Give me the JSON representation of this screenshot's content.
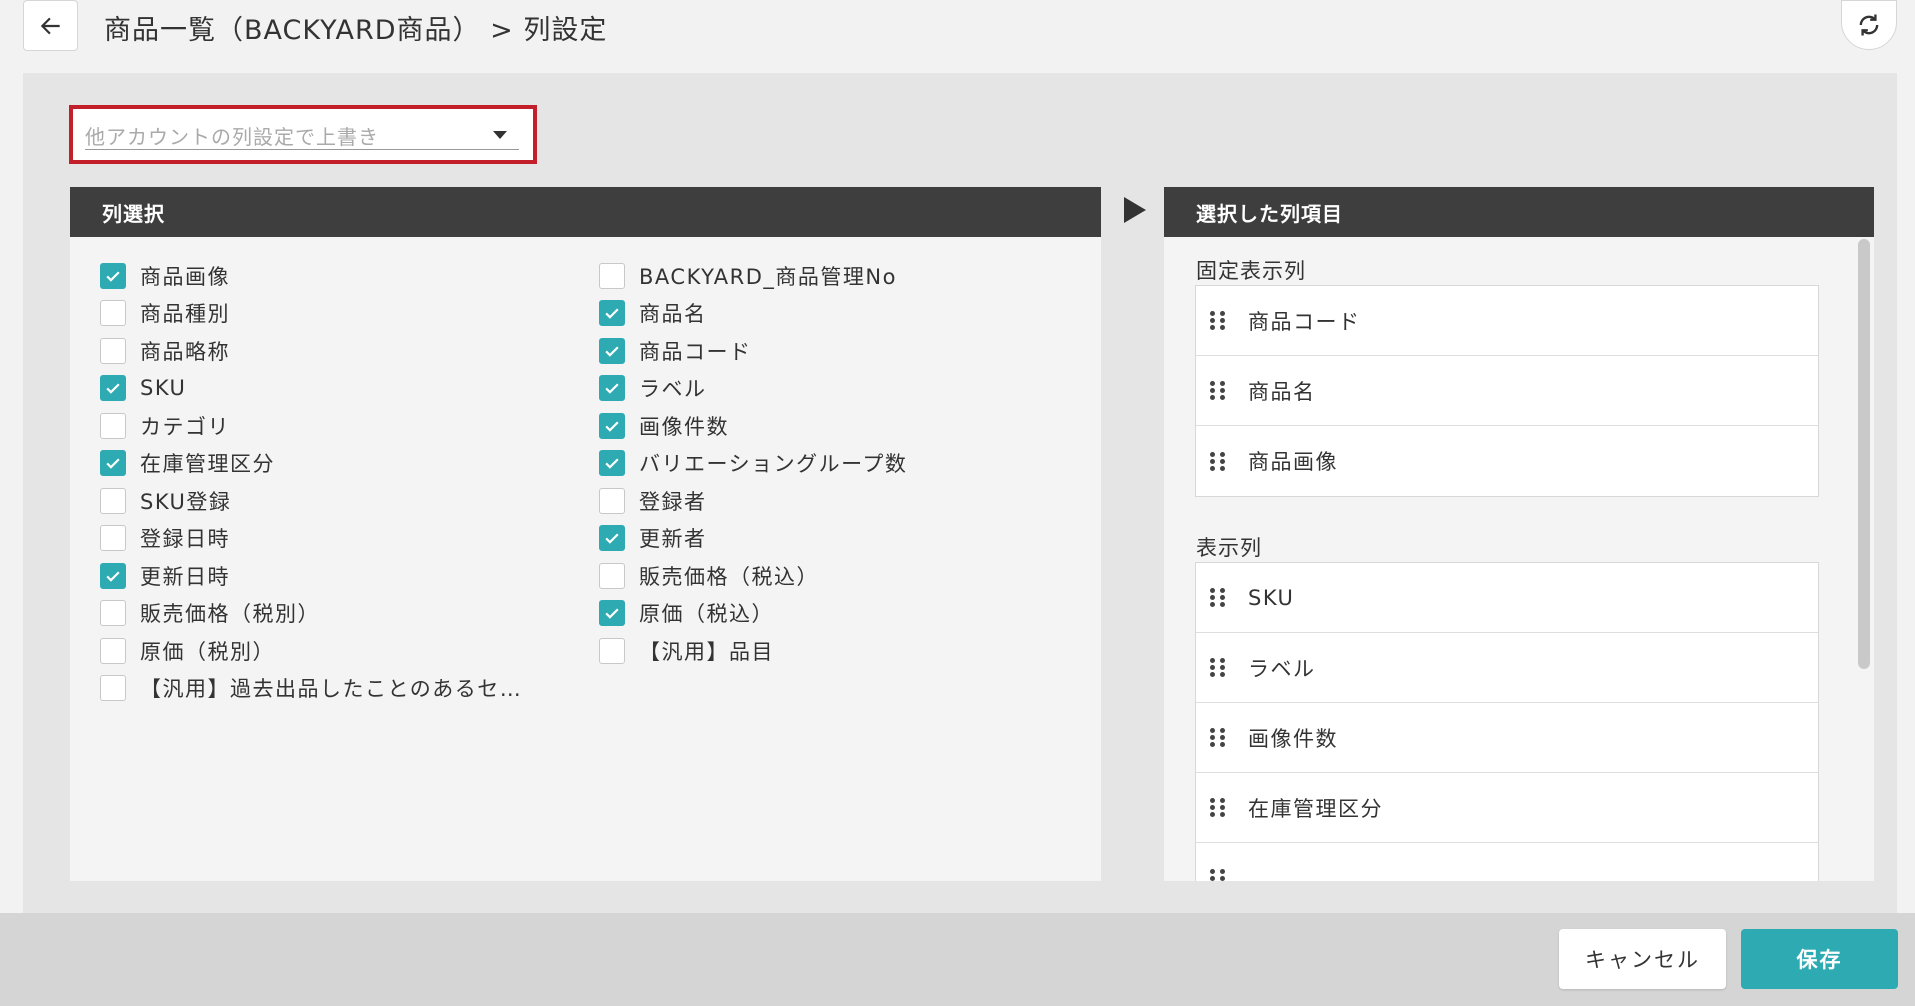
{
  "header": {
    "title": "商品一覧（BACKYARD商品） > 列設定",
    "back_icon": "arrow-left-icon",
    "refresh_icon": "refresh-icon"
  },
  "account_select": {
    "placeholder": "他アカウントの列設定で上書き"
  },
  "column_selection": {
    "title": "列選択",
    "left_items": [
      {
        "label": "商品画像",
        "checked": true
      },
      {
        "label": "商品種別",
        "checked": false
      },
      {
        "label": "商品略称",
        "checked": false
      },
      {
        "label": "SKU",
        "checked": true
      },
      {
        "label": "カテゴリ",
        "checked": false
      },
      {
        "label": "在庫管理区分",
        "checked": true
      },
      {
        "label": "SKU登録",
        "checked": false
      },
      {
        "label": "登録日時",
        "checked": false
      },
      {
        "label": "更新日時",
        "checked": true
      },
      {
        "label": "販売価格（税別）",
        "checked": false
      },
      {
        "label": "原価（税別）",
        "checked": false
      },
      {
        "label": "【汎用】過去出品したことのあるセ…",
        "checked": false
      }
    ],
    "right_items": [
      {
        "label": "BACKYARD_商品管理No",
        "checked": false
      },
      {
        "label": "商品名",
        "checked": true
      },
      {
        "label": "商品コード",
        "checked": true
      },
      {
        "label": "ラベル",
        "checked": true
      },
      {
        "label": "画像件数",
        "checked": true
      },
      {
        "label": "バリエーショングループ数",
        "checked": true
      },
      {
        "label": "登録者",
        "checked": false
      },
      {
        "label": "更新者",
        "checked": true
      },
      {
        "label": "販売価格（税込）",
        "checked": false
      },
      {
        "label": "原価（税込）",
        "checked": true
      },
      {
        "label": "【汎用】品目",
        "checked": false
      }
    ]
  },
  "selected_columns": {
    "title": "選択した列項目",
    "fixed_label": "固定表示列",
    "fixed_items": [
      "商品コード",
      "商品名",
      "商品画像"
    ],
    "display_label": "表示列",
    "display_items": [
      "SKU",
      "ラベル",
      "画像件数",
      "在庫管理区分",
      ""
    ]
  },
  "footer": {
    "cancel_label": "キャンセル",
    "save_label": "保存"
  },
  "colors": {
    "accent": "#2eaab2",
    "highlight_border": "#c21f2a",
    "panel_header": "#3e3e3e"
  }
}
